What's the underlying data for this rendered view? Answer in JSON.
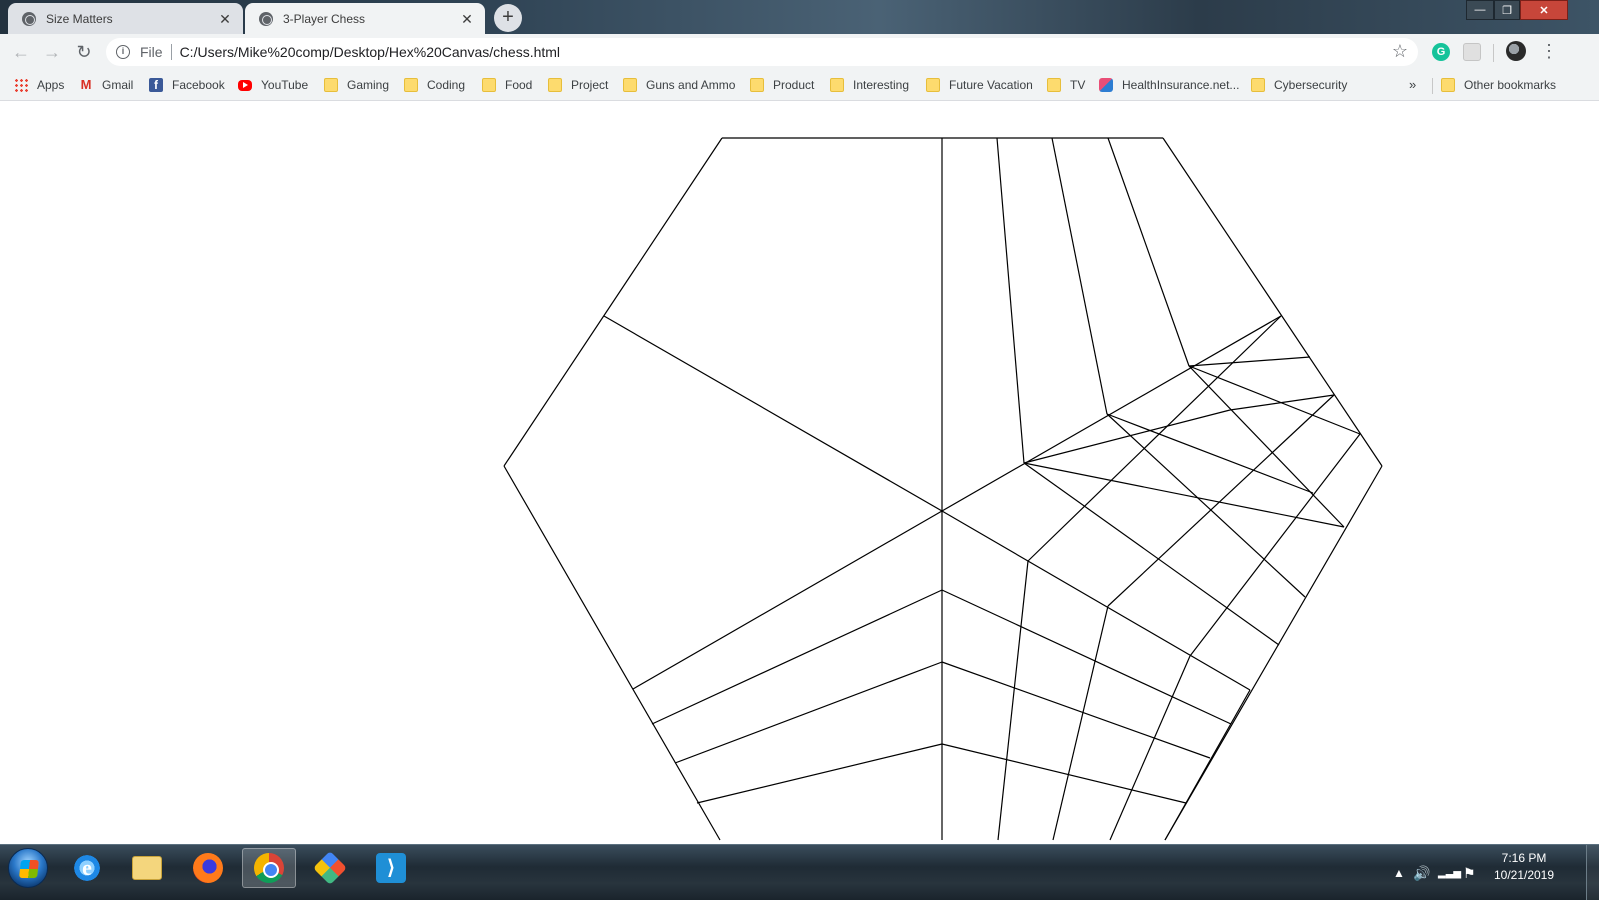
{
  "browser": {
    "tabs": [
      {
        "title": "Size Matters",
        "active": false
      },
      {
        "title": "3-Player Chess",
        "active": true
      }
    ],
    "new_tab_label": "+",
    "window_controls": {
      "minimize": "—",
      "maximize": "❐",
      "close": "✕"
    },
    "address": {
      "scheme_label": "File",
      "url": "C:/Users/Mike%20comp/Desktop/Hex%20Canvas/chess.html"
    },
    "grammarly_letter": "G",
    "bookmarks": [
      {
        "label": "Apps",
        "icon": "apps-grid-icon"
      },
      {
        "label": "Gmail",
        "icon": "gmail-icon"
      },
      {
        "label": "Facebook",
        "icon": "facebook-icon"
      },
      {
        "label": "YouTube",
        "icon": "youtube-icon"
      },
      {
        "label": "Gaming",
        "icon": "folder-icon"
      },
      {
        "label": "Coding",
        "icon": "folder-icon"
      },
      {
        "label": "Food",
        "icon": "folder-icon"
      },
      {
        "label": "Project",
        "icon": "folder-icon"
      },
      {
        "label": "Guns and Ammo",
        "icon": "folder-icon"
      },
      {
        "label": "Product",
        "icon": "folder-icon"
      },
      {
        "label": "Interesting",
        "icon": "folder-icon"
      },
      {
        "label": "Future Vacation",
        "icon": "folder-icon"
      },
      {
        "label": "TV",
        "icon": "folder-icon"
      },
      {
        "label": "HealthInsurance.net...",
        "icon": "healthinsurance-icon"
      },
      {
        "label": "Cybersecurity",
        "icon": "folder-icon"
      }
    ],
    "bookmarks_overflow": "»",
    "other_bookmarks": "Other bookmarks"
  },
  "page": {
    "board_stroke": "#000000",
    "background": "#ffffff"
  },
  "taskbar": {
    "apps": [
      {
        "name": "internet-explorer",
        "letter": "e",
        "active": false
      },
      {
        "name": "file-explorer",
        "active": false
      },
      {
        "name": "firefox",
        "active": false
      },
      {
        "name": "chrome",
        "active": true
      },
      {
        "name": "git",
        "active": false
      },
      {
        "name": "vscode",
        "letter": "⟩",
        "active": false
      }
    ],
    "clock": {
      "time": "7:16 PM",
      "date": "10/21/2019"
    },
    "tray_icons": [
      "show-hidden-icon",
      "volume-icon",
      "network-icon",
      "action-center-flag-icon"
    ]
  }
}
